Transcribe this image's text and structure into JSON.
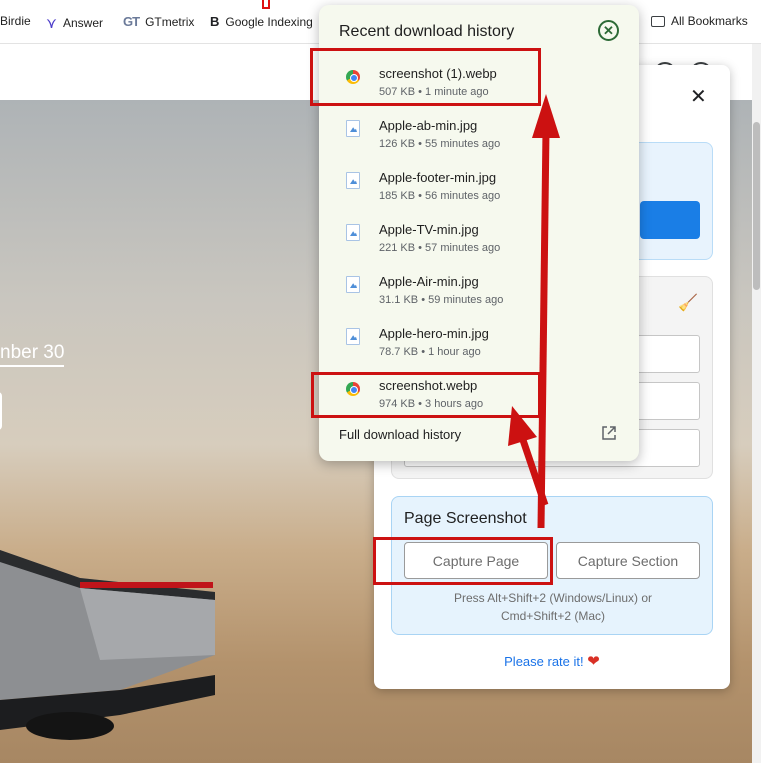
{
  "bookmarks": {
    "items": [
      {
        "label": "Birdie"
      },
      {
        "label": "Answer"
      },
      {
        "label": "GTmetrix",
        "glyph": "GT"
      },
      {
        "label": "Google Indexing",
        "glyph": "B"
      }
    ],
    "all_bookmarks": "All Bookmarks"
  },
  "hero": {
    "date_text": "nber 30"
  },
  "extension": {
    "page_screenshot": {
      "title": "Page Screenshot",
      "capture_page": "Capture Page",
      "capture_section": "Capture Section",
      "hint_line1": "Press Alt+Shift+2 (Windows/Linux) or",
      "hint_line2": "Cmd+Shift+2 (Mac)"
    },
    "rate_text": "Please rate it!"
  },
  "downloads": {
    "title": "Recent download history",
    "items": [
      {
        "name": "screenshot (1).webp",
        "meta": "507 KB • 1 minute ago",
        "icon": "chrome-icon"
      },
      {
        "name": "Apple-ab-min.jpg",
        "meta": "126 KB • 55 minutes ago",
        "icon": "image-file-icon"
      },
      {
        "name": "Apple-footer-min.jpg",
        "meta": "185 KB • 56 minutes ago",
        "icon": "image-file-icon"
      },
      {
        "name": "Apple-TV-min.jpg",
        "meta": "221 KB • 57 minutes ago",
        "icon": "image-file-icon"
      },
      {
        "name": "Apple-Air-min.jpg",
        "meta": "31.1 KB • 59 minutes ago",
        "icon": "image-file-icon"
      },
      {
        "name": "Apple-hero-min.jpg",
        "meta": "78.7 KB • 1 hour ago",
        "icon": "image-file-icon"
      },
      {
        "name": "screenshot.webp",
        "meta": "974 KB • 3 hours ago",
        "icon": "chrome-icon"
      }
    ],
    "full_history": "Full download history"
  },
  "colors": {
    "annotation_red": "#cc1111",
    "popup_bg": "#f6f9ee",
    "accent_blue": "#1a7ee6"
  }
}
